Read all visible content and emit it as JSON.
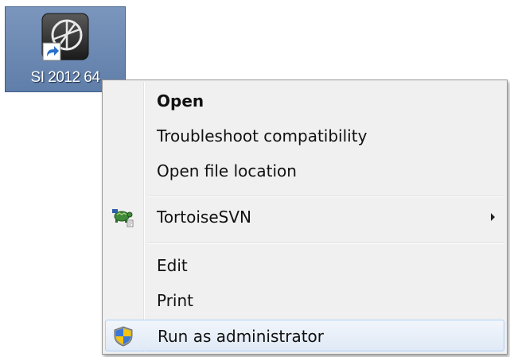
{
  "desktop_icon": {
    "label": "SI 2012 64"
  },
  "context_menu": {
    "items": [
      {
        "label": "Open",
        "bold": true
      },
      {
        "label": "Troubleshoot compatibility"
      },
      {
        "label": "Open file location"
      },
      {
        "label": "TortoiseSVN",
        "icon": "tortoisesvn-icon",
        "submenu": true
      },
      {
        "label": "Edit"
      },
      {
        "label": "Print"
      },
      {
        "label": "Run as administrator",
        "icon": "uac-shield-icon",
        "highlighted": true
      }
    ]
  },
  "colors": {
    "selection_blue": "#6f8bb5",
    "menu_background": "#f0f0f0",
    "hover_border": "#aecff7"
  }
}
